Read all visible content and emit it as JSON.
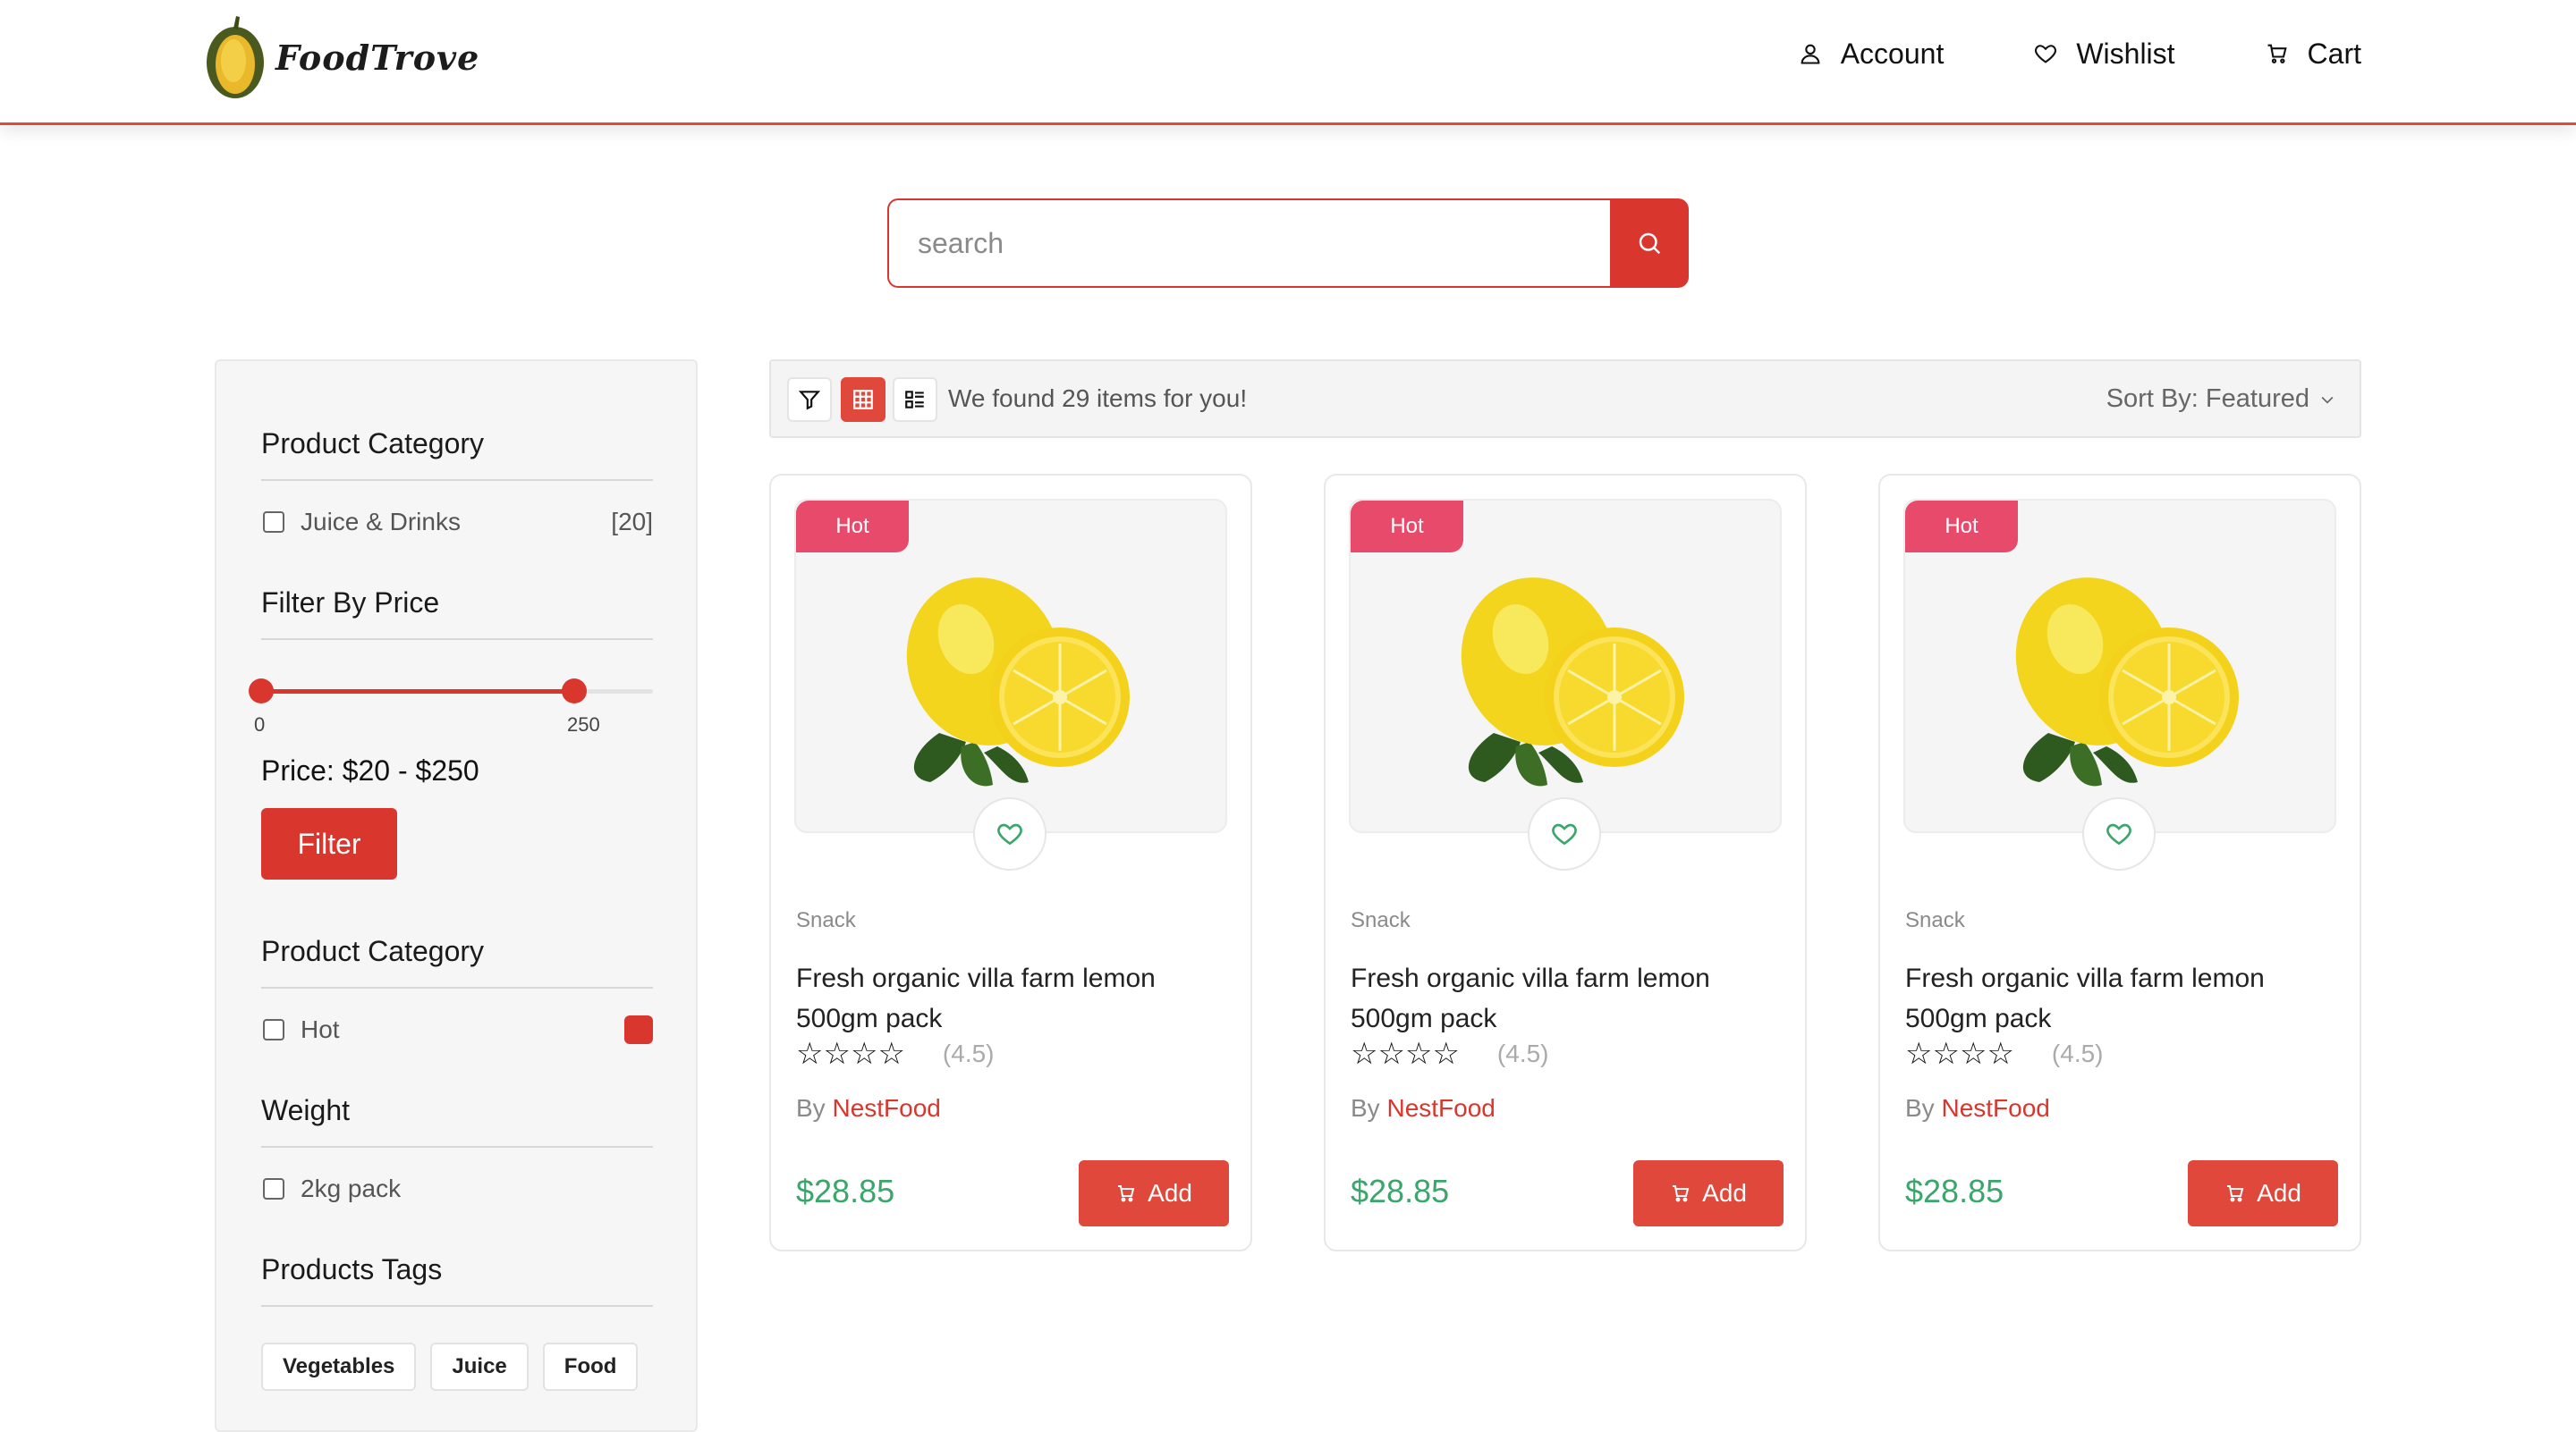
{
  "brand": {
    "logo_text": "FoodTrove",
    "logo_icon": "durian-icon"
  },
  "nav": {
    "account": "Account",
    "wishlist": "Wishlist",
    "cart": "Cart"
  },
  "search": {
    "placeholder": "search",
    "value": ""
  },
  "sidebar": {
    "category_title": "Product Category",
    "category_items": [
      {
        "label": "Juice & Drinks",
        "count": "[20]"
      }
    ],
    "price_title": "Filter By Price",
    "price_min_label": "0",
    "price_max_label": "250",
    "price_range_fraction": [
      0.0,
      0.8
    ],
    "price_text": "Price: $20 - $250",
    "filter_button": "Filter",
    "category2_title": "Product Category",
    "category2_items": [
      {
        "label": "Hot",
        "swatch_color": "#d9362d"
      }
    ],
    "weight_title": "Weight",
    "weight_items": [
      {
        "label": "2kg pack"
      }
    ],
    "tags_title": "Products Tags",
    "tags": [
      "Vegetables",
      "Juice",
      "Food"
    ]
  },
  "toolbar": {
    "found_text": "We found 29 items for you!",
    "sort_label": "Sort By: Featured",
    "view_mode": "grid"
  },
  "products": [
    {
      "badge": "Hot",
      "category": "Snack",
      "title": "Fresh organic villa farm lemon 500gm pack",
      "stars": "☆☆☆☆",
      "rating": "(4.5)",
      "by": "By",
      "brand": "NestFood",
      "price": "$28.85",
      "add_label": "Add"
    },
    {
      "badge": "Hot",
      "category": "Snack",
      "title": "Fresh organic villa farm lemon 500gm pack",
      "stars": "☆☆☆☆",
      "rating": "(4.5)",
      "by": "By",
      "brand": "NestFood",
      "price": "$28.85",
      "add_label": "Add"
    },
    {
      "badge": "Hot",
      "category": "Snack",
      "title": "Fresh organic villa farm lemon 500gm pack",
      "stars": "☆☆☆☆",
      "rating": "(4.5)",
      "by": "By",
      "brand": "NestFood",
      "price": "$28.85",
      "add_label": "Add"
    }
  ],
  "colors": {
    "accent": "#d9362d",
    "badge": "#e84a6b",
    "price": "#3ba66b",
    "heart": "#3ba66b"
  }
}
